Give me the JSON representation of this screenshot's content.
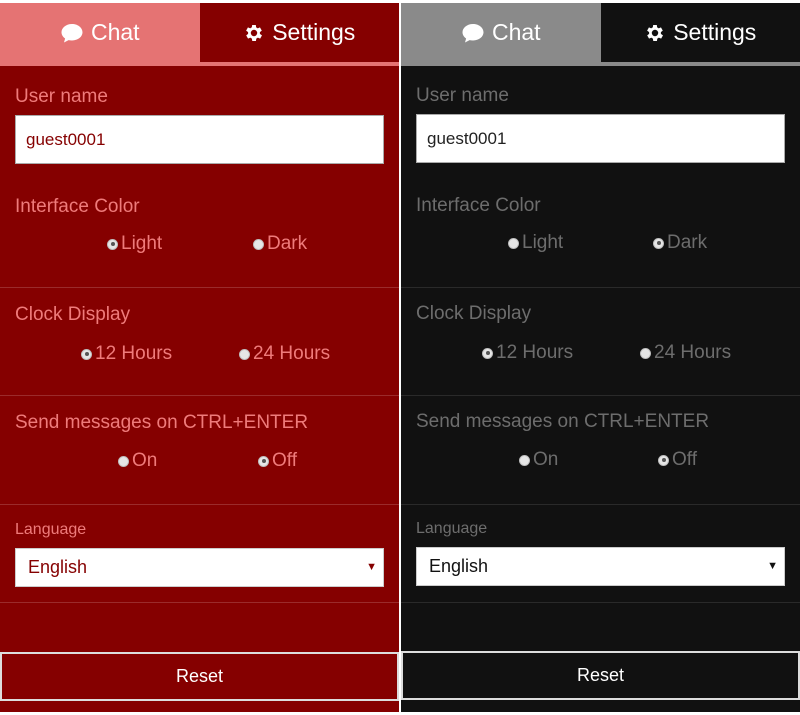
{
  "tabs": {
    "chat": "Chat",
    "settings": "Settings"
  },
  "username": {
    "label": "User name",
    "value": "guest0001"
  },
  "interface_color": {
    "label": "Interface Color",
    "light": "Light",
    "dark": "Dark"
  },
  "clock_display": {
    "label": "Clock Display",
    "h12": "12 Hours",
    "h24": "24 Hours"
  },
  "send_on_ctrl_enter": {
    "label": "Send messages on CTRL+ENTER",
    "on": "On",
    "off": "Off"
  },
  "language": {
    "label": "Language",
    "selected": "English"
  },
  "reset_label": "Reset",
  "panels": [
    {
      "theme": "red",
      "interface_color_selected": "Light",
      "clock_selected": "12 Hours",
      "send_selected": "Off"
    },
    {
      "theme": "dark",
      "interface_color_selected": "Dark",
      "clock_selected": "12 Hours",
      "send_selected": "Off"
    }
  ],
  "colors": {
    "red_accent": "#e57373",
    "red_background": "#850000",
    "dark_accent": "#8a8a8a",
    "dark_background": "#111111"
  },
  "icons": {
    "chat_tab": "chat-bubble-icon",
    "settings_tab": "gear-icon",
    "language_select": "dropdown-arrow-icon"
  }
}
